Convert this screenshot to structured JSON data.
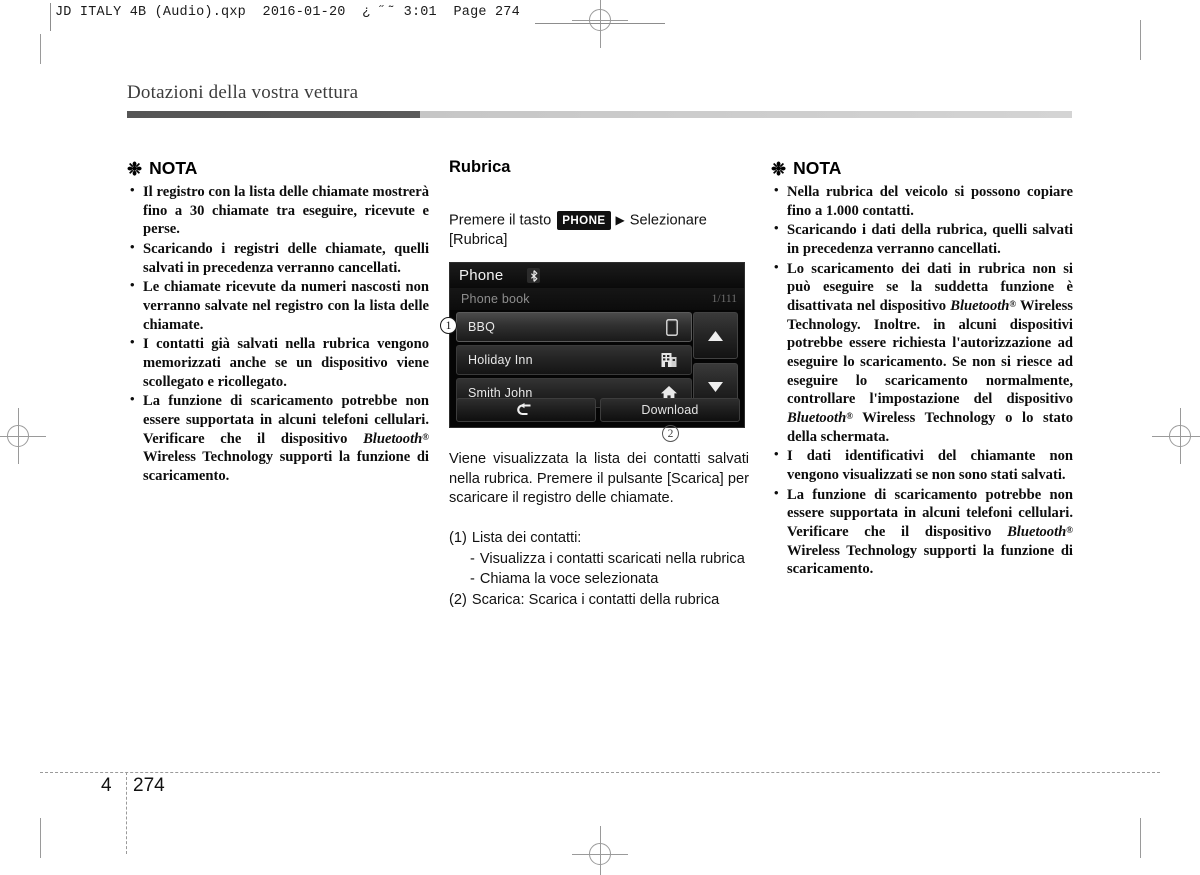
{
  "slug": "JD ITALY 4B (Audio).qxp  2016-01-20  ¿ ˝˜ 3:01  Page 274",
  "running_head": "Dotazioni della vostra vettura",
  "folio": {
    "chapter": "4",
    "page": "274"
  },
  "left_column": {
    "nota_title": "NOTA",
    "asterisk": "❉",
    "items": [
      "Il registro con la lista delle chiamate mostrerà fino a 30 chiamate tra eseguire, ricevute e perse.",
      "Scaricando i registri delle chiamate, quelli salvati in precedenza verranno cancellati.",
      "Le chiamate ricevute da numeri nascosti non verranno salvate nel registro con la lista delle chiamate.",
      "I contatti già salvati nella rubrica vengono memorizzati anche se un dispositivo viene scollegato e ricollegato."
    ],
    "item_bluetooth": {
      "before": "La funzione di scaricamento potrebbe non essere supportata in alcuni telefoni cellulari. Verificare che il dispositivo ",
      "brand": "Bluetooth",
      "reg": "®",
      "after": " Wireless Technology supporti la funzione di scaricamento."
    }
  },
  "middle_column": {
    "section_title": "Rubrica",
    "instruction": {
      "prefix": "Premere il tasto",
      "key": "PHONE",
      "arrow": "▶",
      "suffix": "Selezionare [Rubrica]"
    },
    "head_unit": {
      "title": "Phone",
      "bt_icon": "bluetooth-icon",
      "subtitle": "Phone book",
      "page_indicator": "1/111",
      "contacts": [
        {
          "name": "BBQ",
          "icon": "mobile-phone-icon"
        },
        {
          "name": "Holiday Inn",
          "icon": "office-building-icon"
        },
        {
          "name": "Smith John",
          "icon": "home-icon"
        }
      ],
      "scroll_up": "▲",
      "scroll_down": "▼",
      "back_button": "↶",
      "download_button": "Download",
      "callout_1": "①",
      "callout_2": "②"
    },
    "description": "Viene visualizzata la lista dei contatti salvati nella rubrica. Premere il pulsante [Scarica] per scaricare il registro delle chiamate.",
    "legend": [
      {
        "marker": "(1)",
        "text": "Lista dei contatti:"
      },
      {
        "marker": "-",
        "text": "Visualizza i contatti scaricati nella rubrica",
        "sub": true
      },
      {
        "marker": "-",
        "text": "Chiama la voce selezionata",
        "sub": true
      },
      {
        "marker": "(2)",
        "text": "Scarica: Scarica i contatti della rubrica"
      }
    ]
  },
  "right_column": {
    "nota_title": "NOTA",
    "asterisk": "❉",
    "items": [
      "Nella rubrica del veicolo si possono copiare fino a 1.000 contatti.",
      "Scaricando i dati della rubrica, quelli salvati in precedenza verranno cancellati."
    ],
    "item_download_bt": {
      "before": "Lo scaricamento dei dati in rubrica non si può eseguire se la suddetta funzione è disattivata nel dispositivo ",
      "brand": "Bluetooth",
      "reg": "®",
      "middle": " Wireless Technology. Inoltre. in alcuni dispositivi potrebbe essere richiesta l'autorizzazione ad eseguire lo scaricamento. Se non si riesce ad eseguire lo scaricamento normalmente, controllare l'impostazione del dispositivo ",
      "brand2": "Bluetooth",
      "reg2": "®",
      "after": " Wireless Technology o lo stato della schermata."
    },
    "item_caller_id": "I dati identificativi del chiamante non vengono visualizzati se non sono stati salvati.",
    "item_bluetooth": {
      "before": "La funzione di scaricamento potrebbe non essere supportata in alcuni telefoni cellulari. Verificare che il dispositivo ",
      "brand": "Bluetooth",
      "reg": "®",
      "after": " Wireless Technology supporti la funzione di scaricamento."
    }
  }
}
